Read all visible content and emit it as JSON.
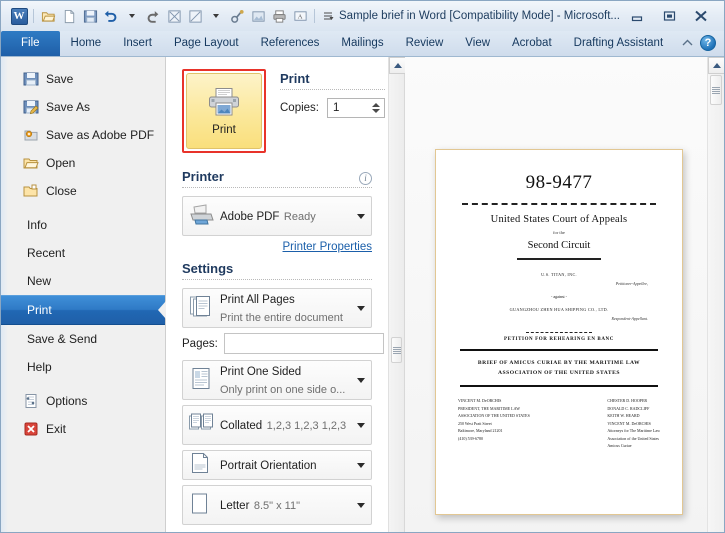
{
  "titlebar": {
    "document_title": "Sample brief in Word [Compatibility Mode]  -  Microsoft...",
    "word_logo": "W",
    "minimize": "–",
    "restore": "□",
    "close": "✕",
    "qat_icons": [
      "open-icon",
      "new-document-icon",
      "save-icon",
      "undo-icon",
      "redo-icon",
      "export-pdf-icon",
      "export-pdf-2-icon",
      "attach-icon",
      "image-icon",
      "print-icon",
      "comment-icon",
      "customize-qat-icon"
    ]
  },
  "ribbon": {
    "tabs": [
      {
        "label": "File",
        "selected": true
      },
      {
        "label": "Home",
        "selected": false
      },
      {
        "label": "Insert",
        "selected": false
      },
      {
        "label": "Page Layout",
        "selected": false
      },
      {
        "label": "References",
        "selected": false
      },
      {
        "label": "Mailings",
        "selected": false
      },
      {
        "label": "Review",
        "selected": false
      },
      {
        "label": "View",
        "selected": false
      },
      {
        "label": "Acrobat",
        "selected": false
      },
      {
        "label": "Drafting Assistant",
        "selected": false
      }
    ],
    "help_label": "?"
  },
  "sidebar": {
    "items": [
      {
        "label": "Save",
        "icon": "save-icon",
        "type": "icon"
      },
      {
        "label": "Save As",
        "icon": "save-as-icon",
        "type": "icon"
      },
      {
        "label": "Save as Adobe PDF",
        "icon": "adobe-pdf-icon",
        "type": "icon"
      },
      {
        "label": "Open",
        "icon": "open-folder-icon",
        "type": "icon"
      },
      {
        "label": "Close",
        "icon": "close-folder-icon",
        "type": "icon"
      },
      {
        "label": "Info",
        "icon": "",
        "type": "plain"
      },
      {
        "label": "Recent",
        "icon": "",
        "type": "plain"
      },
      {
        "label": "New",
        "icon": "",
        "type": "plain"
      },
      {
        "label": "Print",
        "icon": "",
        "type": "plain",
        "selected": true
      },
      {
        "label": "Save & Send",
        "icon": "",
        "type": "plain"
      },
      {
        "label": "Help",
        "icon": "",
        "type": "plain"
      },
      {
        "label": "Options",
        "icon": "options-icon",
        "type": "icon"
      },
      {
        "label": "Exit",
        "icon": "exit-icon",
        "type": "icon"
      }
    ]
  },
  "print_pane": {
    "print_button_label": "Print",
    "print_button_icon": "printer-icon",
    "section_print_title": "Print",
    "copies_label": "Copies:",
    "copies_value": "1",
    "section_printer_title": "Printer",
    "printer_name": "Adobe PDF",
    "printer_status": "Ready",
    "printer_properties_link": "Printer Properties",
    "section_settings_title": "Settings",
    "settings": [
      {
        "main": "Print All Pages",
        "sub": "Print the entire document",
        "icon": "pages-stack-icon"
      },
      {
        "main": "Print One Sided",
        "sub": "Only print on one side o...",
        "icon": "one-sided-icon"
      },
      {
        "main": "Collated",
        "sub": "1,2,3   1,2,3   1,2,3",
        "icon": "collate-icon"
      },
      {
        "main": "Portrait Orientation",
        "sub": "",
        "icon": "portrait-icon"
      },
      {
        "main": "Letter",
        "sub": "8.5\" x 11\"",
        "icon": "paper-size-icon"
      }
    ],
    "pages_label": "Pages:",
    "pages_value": "",
    "pages_placeholder": "",
    "info_icon": "i"
  },
  "preview": {
    "document": {
      "case_number": "98-9477",
      "court": "United States Court of Appeals",
      "for_the": "for the",
      "circuit": "Second Circuit",
      "party_petitioner": "U.S. TITAN, INC.",
      "party_petitioner_role": "Petitioner-Appellee,",
      "versus": "- against -",
      "party_respondent": "GUANGZHOU ZHEN HUA SHIPPING CO., LTD.",
      "party_respondent_role": "Respondent-Appellant.",
      "petition_line": "PETITION FOR REHEARING EN BANC",
      "brief_title_line1": "BRIEF OF AMICUS CURIAE BY THE MARITIME LAW",
      "brief_title_line2": "ASSOCIATION OF THE UNITED STATES",
      "counsel_left": [
        "VINCENT M. DeORCHIS",
        "PRESIDENT, THE MARITIME LAW",
        "ASSOCIATION OF THE UNITED STATES",
        "250 West Pratt Street",
        "Baltimore, Maryland 21201",
        "(410) 539-6780"
      ],
      "counsel_right": [
        "CHESTER D. HOOPER",
        "DONALD C. RADCLIFF",
        "KEITH W. HEARD",
        "VINCENT M. DeORCHIS",
        "Attorneys for The Maritime Law",
        "Association of the United States",
        "Amicus Curiae"
      ]
    }
  },
  "colors": {
    "accent_blue": "#1f5fa8",
    "file_tab_blue": "#2f7bc4",
    "print_highlight_red": "#e8332a",
    "print_button_yellow": "#fbe89b",
    "link_blue": "#1b5faa"
  }
}
